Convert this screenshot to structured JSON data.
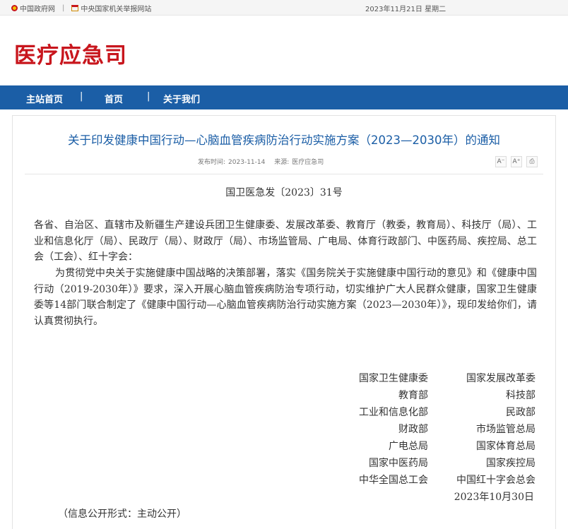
{
  "topbar": {
    "links": [
      "中国政府网",
      "中央国家机关举报网站"
    ],
    "separator": "|",
    "date": "2023年11月21日 星期二"
  },
  "header": {
    "title": "医疗应急司"
  },
  "nav": {
    "items": [
      "主站首页",
      "首页",
      "关于我们"
    ],
    "separator": "|"
  },
  "article": {
    "title": "关于印发健康中国行动—心脑血管疾病防治行动实施方案（2023—2030年）的通知",
    "meta": {
      "date_label": "发布时间:",
      "date": "2023-11-14",
      "source_label": "来源:",
      "source": "医疗应急司"
    },
    "tools": {
      "font_smaller": "A⁻",
      "font_larger": "A⁺",
      "print": "⎙"
    },
    "doc_number": "国卫医急发〔2023〕31号",
    "paragraphs": [
      "各省、自治区、直辖市及新疆生产建设兵团卫生健康委、发展改革委、教育厅（教委，教育局）、科技厅（局）、工业和信息化厅（局）、民政厅（局）、财政厅（局）、市场监管局、广电局、体育行政部门、中医药局、疾控局、总工会（工会）、红十字会：",
      "为贯彻党中央关于实施健康中国战略的决策部署，落实《国务院关于实施健康中国行动的意见》和《健康中国行动（2019-2030年）》要求，深入开展心脑血管疾病防治专项行动，切实维护广大人民群众健康，国家卫生健康委等14部门联合制定了《健康中国行动—心脑血管疾病防治行动实施方案（2023—2030年）》，现印发给你们，请认真贯彻执行。"
    ],
    "signers": [
      [
        "国家卫生健康委",
        "国家发展改革委"
      ],
      [
        "教育部",
        "科技部"
      ],
      [
        "工业和信息化部",
        "民政部"
      ],
      [
        "财政部",
        "市场监管总局"
      ],
      [
        "广电总局",
        "国家体育总局"
      ],
      [
        "国家中医药局",
        "国家疾控局"
      ],
      [
        "中华全国总工会",
        "中国红十字会总会"
      ]
    ],
    "sign_date": "2023年10月30日",
    "disclosure": "（信息公开形式：主动公开）"
  },
  "colors": {
    "brand_red": "#c8161d",
    "nav_blue": "#1b5ea6",
    "title_blue": "#1b5ea6"
  }
}
